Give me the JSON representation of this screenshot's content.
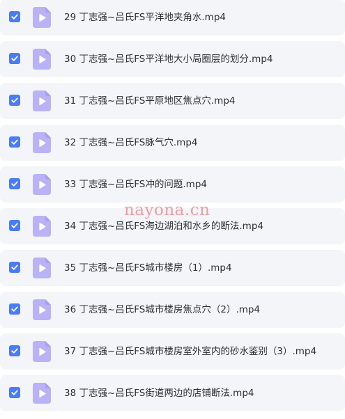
{
  "colors": {
    "checkbox": "#4b7cf5",
    "file_icon": "#b9b2f7",
    "file_icon_play": "#ffffff",
    "row_background": "#f4f5f9",
    "text": "#2b2f36",
    "watermark": "#ee8c8c"
  },
  "icons": {
    "checkbox": "check-icon",
    "file": "video-file-play-icon"
  },
  "files": [
    {
      "name": "29 丁志强~吕氏FS平洋地夹角水.mp4",
      "checked": true
    },
    {
      "name": "30 丁志强~吕氏FS平洋地大小局圈层的划分.mp4",
      "checked": true
    },
    {
      "name": "31 丁志强~吕氏FS平原地区焦点穴.mp4",
      "checked": true
    },
    {
      "name": "32 丁志强~吕氏FS脉气穴.mp4",
      "checked": true
    },
    {
      "name": "33 丁志强~吕氏FS冲的问题.mp4",
      "checked": true
    },
    {
      "name": "34 丁志强~吕氏FS海边湖泊和水乡的断法.mp4",
      "checked": true
    },
    {
      "name": "35 丁志强~吕氏FS城市楼房（1）.mp4",
      "checked": true
    },
    {
      "name": "36 丁志强~吕氏FS城市楼房焦点穴（2）.mp4",
      "checked": true
    },
    {
      "name": "37 丁志强~吕氏FS城市楼房室外室内的砂水鉴别（3）.mp4",
      "checked": true
    },
    {
      "name": "38 丁志强~吕氏FS街道两边的店铺断法.mp4",
      "checked": true
    }
  ],
  "watermark": "nayona.cn"
}
